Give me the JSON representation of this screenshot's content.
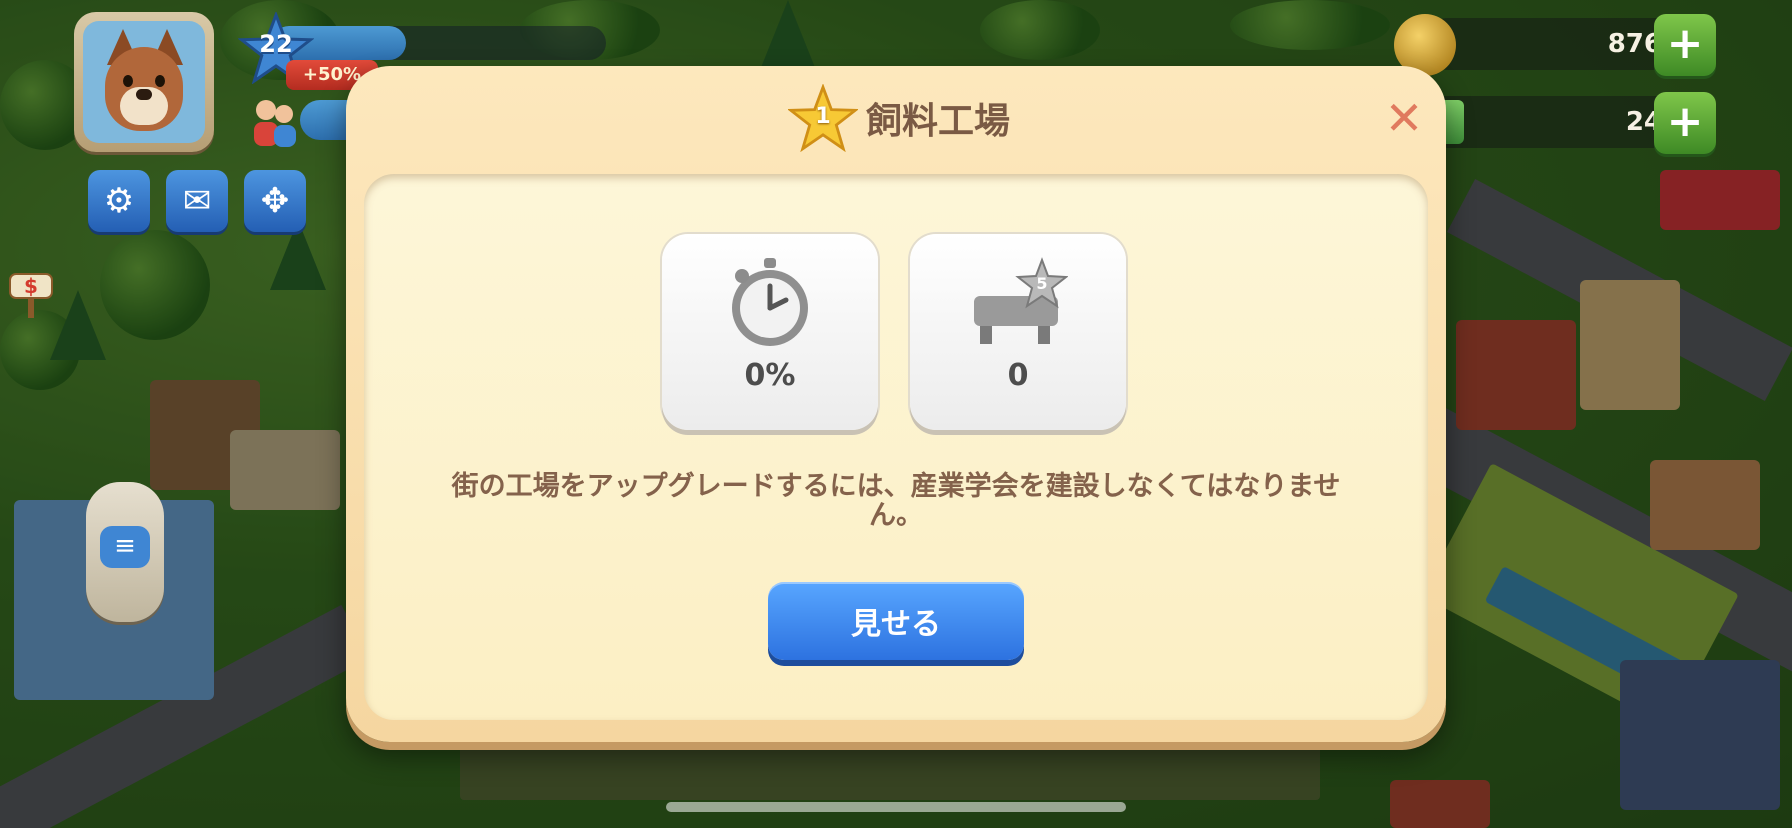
{
  "hud": {
    "level": "22",
    "xp_progress": 0.4,
    "bonus_label": "+50%",
    "coins": "876",
    "cash": "24",
    "settings_icon": "gear-icon",
    "mail_icon": "envelope-icon",
    "move_icon": "move-arrows-icon",
    "chat_icon": "chat-bubble-icon",
    "plus_label": "+"
  },
  "dialog": {
    "star_level": "1",
    "title": "飼料工場",
    "close_label": "✕",
    "cards": [
      {
        "icon": "stopwatch-icon",
        "value": "0%"
      },
      {
        "icon": "table-star-icon",
        "badge": "5",
        "value": "0"
      }
    ],
    "message": "街の工場をアップグレードするには、産業学会を建設しなくてはなりません。",
    "button_label": "見せる"
  },
  "colors": {
    "dialog_bg": "#fde8bd",
    "title_text": "#7a5a44",
    "message_text": "#84624b",
    "button_blue": "#2d72e0",
    "close_x": "#e07a5e"
  }
}
